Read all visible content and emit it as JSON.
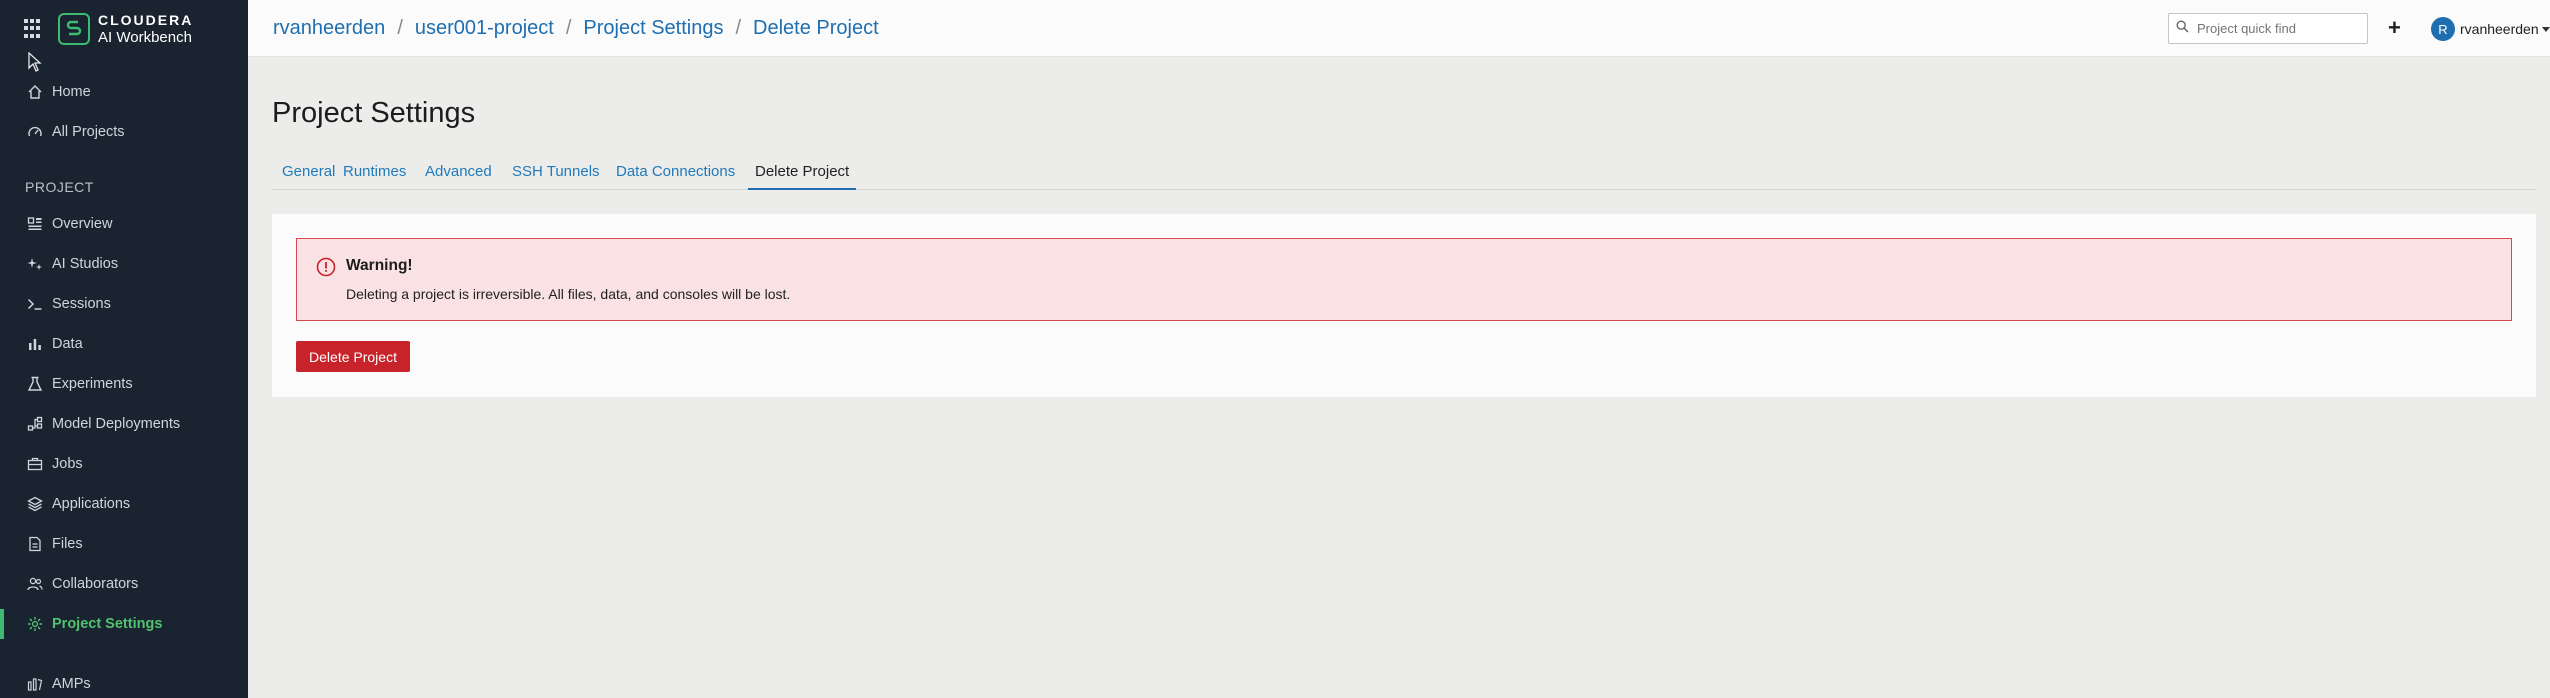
{
  "brand": {
    "name_top": "CLOUDERA",
    "name_bottom": "AI Workbench",
    "accent": "#3dbb70"
  },
  "sidebar": {
    "top_items": [
      {
        "label": "Home",
        "icon": "home-icon"
      },
      {
        "label": "All Projects",
        "icon": "gauge-icon"
      }
    ],
    "section_label": "PROJECT",
    "items": [
      {
        "label": "Overview",
        "icon": "overview-icon"
      },
      {
        "label": "AI Studios",
        "icon": "sparkle-icon"
      },
      {
        "label": "Sessions",
        "icon": "terminal-icon"
      },
      {
        "label": "Data",
        "icon": "bar-chart-icon"
      },
      {
        "label": "Experiments",
        "icon": "flask-icon"
      },
      {
        "label": "Model Deployments",
        "icon": "model-icon"
      },
      {
        "label": "Jobs",
        "icon": "briefcase-icon"
      },
      {
        "label": "Applications",
        "icon": "layers-icon"
      },
      {
        "label": "Files",
        "icon": "file-icon"
      },
      {
        "label": "Collaborators",
        "icon": "users-icon"
      },
      {
        "label": "Project Settings",
        "icon": "gear-icon",
        "active": true
      },
      {
        "label": "AMPs",
        "icon": "amps-icon"
      }
    ]
  },
  "header": {
    "breadcrumb": [
      "rvanheerden",
      "user001-project",
      "Project Settings",
      "Delete Project"
    ],
    "search_placeholder": "Project quick find",
    "add_label": "+",
    "user": {
      "initial": "R",
      "name": "rvanheerden"
    }
  },
  "main": {
    "title": "Project Settings",
    "tabs": [
      {
        "label": "General"
      },
      {
        "label": "Runtimes"
      },
      {
        "label": "Advanced"
      },
      {
        "label": "SSH Tunnels"
      },
      {
        "label": "Data Connections"
      },
      {
        "label": "Delete Project",
        "active": true
      }
    ],
    "warning": {
      "title": "Warning!",
      "message": "Deleting a project is irreversible. All files, data, and consoles will be lost."
    },
    "delete_button": "Delete Project"
  },
  "colors": {
    "link": "#1f6fb0",
    "danger": "#c8232b",
    "sidebar_bg": "#1a2330"
  }
}
